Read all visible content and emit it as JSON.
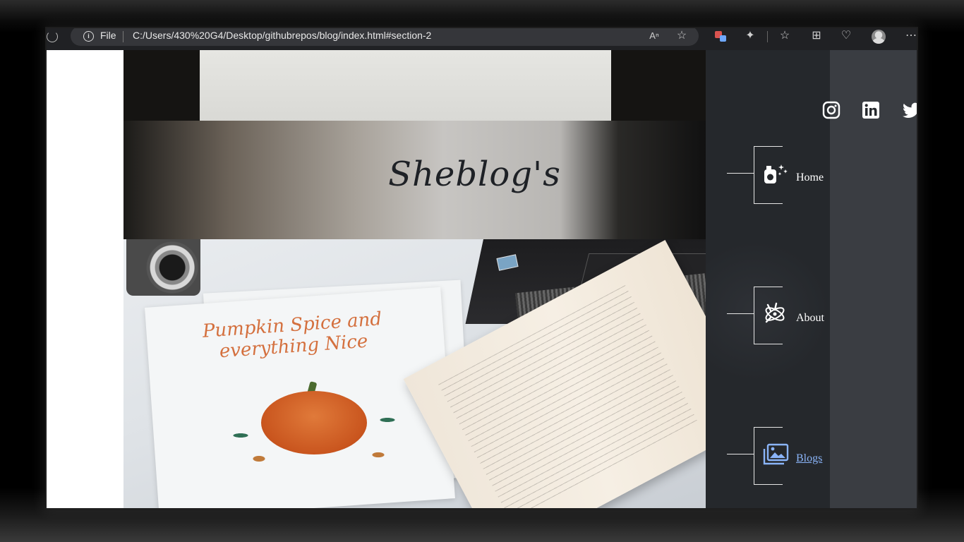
{
  "browser": {
    "file_label": "File",
    "url": "C:/Users/430%20G4/Desktop/githubrepos/blog/index.html#section-2",
    "toolbar_icons": [
      "read-aloud-icon",
      "favorite-star-icon",
      "extension-icon",
      "puzzle-icon",
      "favorites-icon",
      "collections-icon",
      "performance-icon",
      "profile-avatar",
      "more-icon"
    ]
  },
  "hero": {
    "site_title": "Sheblog's",
    "artwork_text": "Pumpkin Spice and everything Nice"
  },
  "sidebar": {
    "social": [
      "instagram-icon",
      "linkedin-icon",
      "twitter-icon"
    ],
    "nav": [
      {
        "label": "Home",
        "icon": "perfume-sparkle-icon"
      },
      {
        "label": "About",
        "icon": "atom-cross-icon"
      },
      {
        "label": "Blogs",
        "icon": "images-gallery-icon",
        "active": true
      }
    ]
  },
  "colors": {
    "sidebar_bg": "#25282c",
    "sidebar_panel": "#3a3d42",
    "link_color": "#8ab4f8",
    "title_color": "#1e2126"
  }
}
